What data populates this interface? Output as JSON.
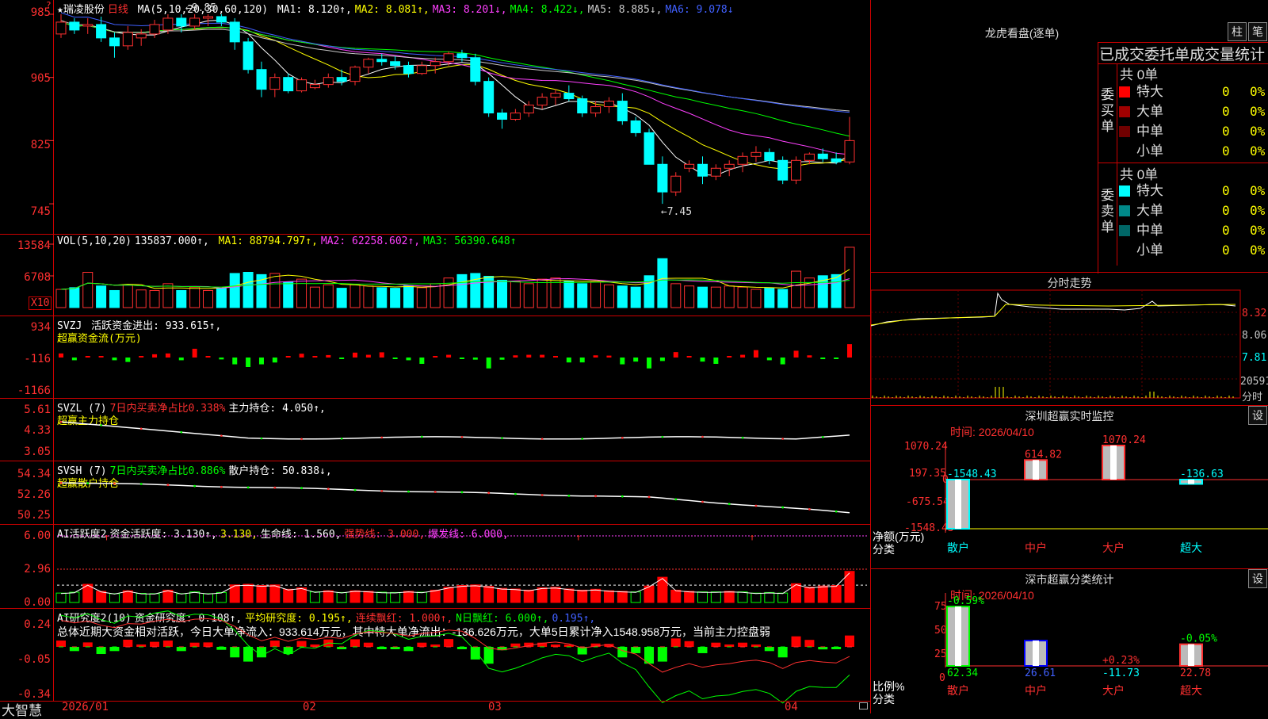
{
  "brand": "大智慧",
  "stock": {
    "name": "★瑞凌股份",
    "period": "日线",
    "ma_label": "MA(5,10,20,30,60,120)",
    "ma": [
      {
        "t": "MA1: 8.120↑,",
        "color": "#ffffff"
      },
      {
        "t": "MA2: 8.081↑,",
        "color": "#ffff00"
      },
      {
        "t": "MA3: 8.201↓,",
        "color": "#ff40ff"
      },
      {
        "t": "MA4: 8.422↓,",
        "color": "#00ff00"
      },
      {
        "t": "MA5: 8.885↓,",
        "color": "#c8c8c8"
      },
      {
        "t": "MA6: 9.078↓",
        "color": "#4060ff"
      }
    ],
    "high_mark": "9.85",
    "low_mark": "7.45"
  },
  "price_axis": [
    "985",
    "905",
    "825",
    "745"
  ],
  "vol": {
    "label": "VOL(5,10,20)",
    "value": "135837.000↑,",
    "ma1": "MA1: 88794.797↑,",
    "ma2": "MA2: 62258.602↑,",
    "ma3": "MA3: 56390.648↑",
    "axis": [
      "13584",
      "6708"
    ],
    "unit": "X10"
  },
  "svzj": {
    "label": "SVZJ",
    "text": "活跃资金进出: 933.615↑,",
    "sub": "超赢资金流(万元)",
    "axis": [
      "934",
      "-116",
      "-1166"
    ]
  },
  "svzl": {
    "label": "SVZL (7)",
    "text1": "7日内买卖净占比0.338%",
    "text2": "主力持仓: 4.050↑,",
    "sub": "超赢主力持仓",
    "axis": [
      "5.61",
      "4.33",
      "3.05"
    ]
  },
  "svsh": {
    "label": "SVSH (7)",
    "text1": "7日内买卖净占比0.886%",
    "text2": "散户持仓: 50.838↓,",
    "sub": "超赢散户持仓",
    "axis": [
      "54.34",
      "52.26",
      "50.25"
    ]
  },
  "ai1": {
    "label": "AI活跃度2",
    "t1": "资金活跃度: 3.130↑,",
    "t2": "3.130,",
    "t3": "生命线: 1.560,",
    "t4": "强势线: 3.000,",
    "t5": "爆发线: 6.000,",
    "axis": [
      "6.00",
      "2.96",
      "0.00"
    ]
  },
  "ai2": {
    "label": "AI研究度2(10)",
    "t1": "资金研究度: 0.108↑,",
    "t2": "平均研究度: 0.195↑,",
    "t3": "连续飘红: 1.000↑,",
    "t4": "N日飘红: 6.000↑,",
    "t5": "0.195↑,",
    "summary": "总体近期大资金相对活跃，今日大单净流入：933.614万元，其中特大单净流出：-136.626万元，大单5日累计净入1548.958万元，当前主力控盘弱",
    "axis": [
      "0.24",
      "-0.05",
      "-0.34"
    ]
  },
  "dates": [
    "2026/01",
    "02",
    "03",
    "04"
  ],
  "lh": {
    "title": "龙虎看盘(逐单)",
    "btn1": "柱",
    "btn2": "笔",
    "subtitle": "已成交委托单成交量统计",
    "buy_group": "委买单",
    "sell_group": "委卖单",
    "total_buy": "共 0单",
    "total_sell": "共 0单",
    "rows": [
      {
        "label": "特大",
        "color": "#ff0000",
        "v": "0",
        "p": "0%"
      },
      {
        "label": "大单",
        "color": "#a00000",
        "v": "0",
        "p": "0%"
      },
      {
        "label": "中单",
        "color": "#700000",
        "v": "0",
        "p": "0%"
      },
      {
        "label": "小单",
        "color": "#000000",
        "v": "0",
        "p": "0%"
      }
    ],
    "rows2": [
      {
        "label": "特大",
        "color": "#00ffff",
        "v": "0",
        "p": "0%"
      },
      {
        "label": "大单",
        "color": "#008888",
        "v": "0",
        "p": "0%"
      },
      {
        "label": "中单",
        "color": "#006666",
        "v": "0",
        "p": "0%"
      },
      {
        "label": "小单",
        "color": "#000000",
        "v": "0",
        "p": "0%"
      }
    ]
  },
  "fenshi": {
    "title": "分时走势",
    "axis": [
      "8.32",
      "8.06",
      "7.81",
      "20591",
      "分时"
    ]
  },
  "monitor": {
    "title": "深圳超赢实时监控",
    "set": "设",
    "time": "时间: 2026/04/10",
    "axis": [
      "1070.24",
      "197.35",
      "0",
      "-675.54",
      "-1548.43"
    ],
    "ylabel": "净额(万元)",
    "xlabel": "分类",
    "cats": [
      "散户",
      "中户",
      "大户",
      "超大"
    ]
  },
  "classify": {
    "title": "深市超赢分类统计",
    "set": "设",
    "time": "时间: 2026/04/10",
    "axis": [
      "75",
      "50",
      "25",
      "0"
    ],
    "ylabel": "比例%",
    "xlabel": "分类",
    "cats": [
      "散户",
      "中户",
      "大户",
      "超大"
    ]
  },
  "chart_data": [
    {
      "type": "bar",
      "title": "深圳超赢实时监控",
      "categories": [
        "散户",
        "中户",
        "大户",
        "超大"
      ],
      "values": [
        -1548.43,
        614.82,
        1070.24,
        -136.63
      ],
      "labels": [
        "-1548.43",
        "614.82",
        "1070.24",
        "-136.63"
      ],
      "colors": [
        "#00ffff",
        "#ff3030",
        "#ff3030",
        "#00ffff"
      ],
      "ylabel": "净额(万元)",
      "xlabel": "分类",
      "ylim": [
        -1548.43,
        1070.24
      ]
    },
    {
      "type": "bar",
      "title": "深市超赢分类统计",
      "categories": [
        "散户",
        "中户",
        "大户",
        "超大"
      ],
      "values": [
        62.34,
        26.61,
        -11.73,
        22.78
      ],
      "top_labels": [
        "-0.59%",
        "",
        "+0.23%",
        "-0.05%"
      ],
      "bottom_labels": [
        "62.34",
        "26.61",
        "-11.73",
        "22.78"
      ],
      "colors": [
        "#00ff00",
        "#0000ff",
        "#00ffff",
        "#ff3030"
      ],
      "ylabel": "比例%",
      "xlabel": "分类",
      "ylim": [
        0,
        75
      ]
    },
    {
      "type": "line",
      "title": "★瑞凌股份 日线",
      "ohlc": [
        [
          9.6,
          9.85,
          9.55,
          9.75
        ],
        [
          9.75,
          9.8,
          9.6,
          9.65
        ],
        [
          9.7,
          9.8,
          9.6,
          9.72
        ],
        [
          9.72,
          9.82,
          9.5,
          9.55
        ],
        [
          9.55,
          9.62,
          9.3,
          9.45
        ],
        [
          9.45,
          9.7,
          9.4,
          9.62
        ],
        [
          9.55,
          9.66,
          9.45,
          9.6
        ],
        [
          9.6,
          9.78,
          9.55,
          9.72
        ],
        [
          9.65,
          9.85,
          9.6,
          9.8
        ],
        [
          9.8,
          9.85,
          9.62,
          9.7
        ],
        [
          9.7,
          9.85,
          9.65,
          9.8
        ],
        [
          9.8,
          9.85,
          9.7,
          9.82
        ],
        [
          9.82,
          9.85,
          9.7,
          9.75
        ],
        [
          9.75,
          9.8,
          9.4,
          9.5
        ],
        [
          9.5,
          9.55,
          9.1,
          9.15
        ],
        [
          9.15,
          9.25,
          8.8,
          8.9
        ],
        [
          8.9,
          9.1,
          8.8,
          9.05
        ],
        [
          9.05,
          9.1,
          8.85,
          8.88
        ],
        [
          8.88,
          9.05,
          8.86,
          9.02
        ],
        [
          8.92,
          9.02,
          8.9,
          8.96
        ],
        [
          8.96,
          9.1,
          8.92,
          9.05
        ],
        [
          9.05,
          9.15,
          8.95,
          9.0
        ],
        [
          9.0,
          9.2,
          8.95,
          9.18
        ],
        [
          9.18,
          9.3,
          9.1,
          9.28
        ],
        [
          9.28,
          9.35,
          9.2,
          9.25
        ],
        [
          9.25,
          9.32,
          9.15,
          9.2
        ],
        [
          9.2,
          9.25,
          9.05,
          9.1
        ],
        [
          9.1,
          9.25,
          9.08,
          9.2
        ],
        [
          9.2,
          9.3,
          9.1,
          9.25
        ],
        [
          9.25,
          9.38,
          9.2,
          9.35
        ],
        [
          9.35,
          9.4,
          9.25,
          9.3
        ],
        [
          9.3,
          9.35,
          8.95,
          9.0
        ],
        [
          9.0,
          9.05,
          8.55,
          8.6
        ],
        [
          8.6,
          8.65,
          8.4,
          8.52
        ],
        [
          8.52,
          8.65,
          8.5,
          8.6
        ],
        [
          8.6,
          8.75,
          8.55,
          8.7
        ],
        [
          8.7,
          8.85,
          8.65,
          8.8
        ],
        [
          8.8,
          8.9,
          8.7,
          8.85
        ],
        [
          8.85,
          8.95,
          8.75,
          8.78
        ],
        [
          8.78,
          8.82,
          8.55,
          8.6
        ],
        [
          8.6,
          8.75,
          8.55,
          8.68
        ],
        [
          8.68,
          8.8,
          8.6,
          8.75
        ],
        [
          8.75,
          8.85,
          8.45,
          8.5
        ],
        [
          8.5,
          8.55,
          8.3,
          8.35
        ],
        [
          8.35,
          8.4,
          7.95,
          7.95
        ],
        [
          7.95,
          8.05,
          7.45,
          7.6
        ],
        [
          7.6,
          7.85,
          7.55,
          7.8
        ],
        [
          7.9,
          8.0,
          7.85,
          7.95
        ],
        [
          7.95,
          8.05,
          7.7,
          7.8
        ],
        [
          7.8,
          7.95,
          7.75,
          7.9
        ],
        [
          7.9,
          8.0,
          7.8,
          7.95
        ],
        [
          7.95,
          8.1,
          7.85,
          8.05
        ],
        [
          8.05,
          8.18,
          7.98,
          8.1
        ],
        [
          8.1,
          8.15,
          7.95,
          8.0
        ],
        [
          8.0,
          8.05,
          7.7,
          7.75
        ],
        [
          7.75,
          8.05,
          7.7,
          8.0
        ],
        [
          8.0,
          8.1,
          7.95,
          8.08
        ],
        [
          8.08,
          8.15,
          7.98,
          8.02
        ],
        [
          8.02,
          8.1,
          7.95,
          7.98
        ],
        [
          7.98,
          8.55,
          7.95,
          8.25
        ]
      ],
      "volume": [
        3200,
        3500,
        6200,
        3800,
        3000,
        4000,
        3100,
        3000,
        4200,
        3000,
        3600,
        3000,
        3400,
        6000,
        6200,
        5800,
        6000,
        4500,
        5000,
        3600,
        4000,
        3400,
        4000,
        3800,
        3500,
        3400,
        3800,
        3500,
        4200,
        5200,
        5800,
        6000,
        5500,
        4800,
        4600,
        4200,
        5000,
        5200,
        4600,
        4200,
        4500,
        4000,
        3800,
        3600,
        5600,
        8600,
        4200,
        3800,
        3600,
        3600,
        3800,
        3600,
        3200,
        3400,
        3200,
        6400,
        5200,
        5600,
        5800,
        10600
      ],
      "ylim": [
        7.2,
        9.95
      ]
    }
  ]
}
